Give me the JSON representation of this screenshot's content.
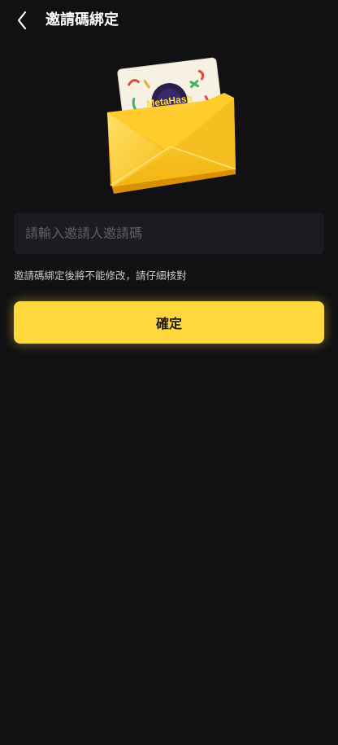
{
  "header": {
    "title": "邀請碼綁定",
    "back_icon": "chevron-left-icon"
  },
  "illustration": {
    "card_brand": "MetaHash",
    "envelope_color": "#f7c51f",
    "brand_color": "#ffd83b"
  },
  "form": {
    "input_value": "",
    "input_placeholder": "請輸入邀請人邀請碼",
    "notice": "邀請碼綁定後將不能修改，請仔細核對",
    "confirm_label": "確定"
  },
  "colors": {
    "background": "#111113",
    "input_background": "#1b1c21",
    "accent": "#ffd83b"
  }
}
